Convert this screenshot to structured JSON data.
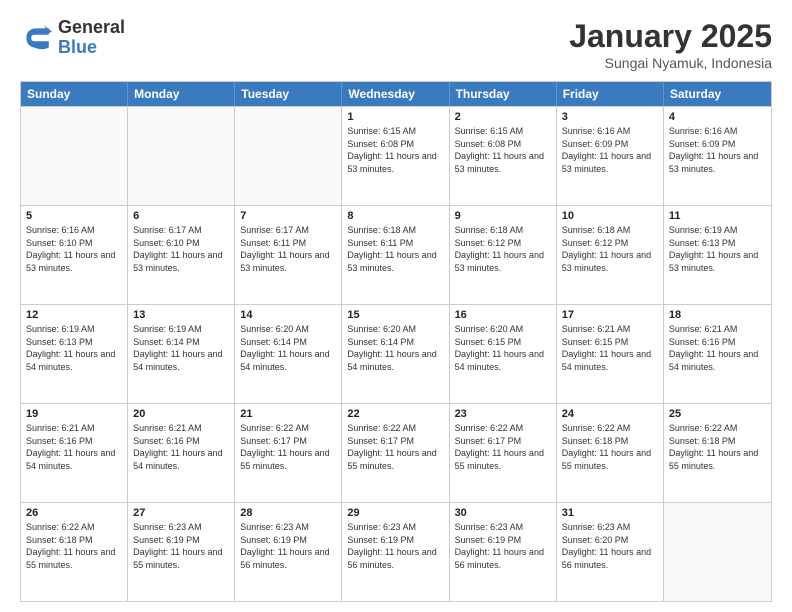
{
  "logo": {
    "general": "General",
    "blue": "Blue"
  },
  "header": {
    "month": "January 2025",
    "location": "Sungai Nyamuk, Indonesia"
  },
  "days": [
    "Sunday",
    "Monday",
    "Tuesday",
    "Wednesday",
    "Thursday",
    "Friday",
    "Saturday"
  ],
  "weeks": [
    [
      {
        "day": "",
        "info": ""
      },
      {
        "day": "",
        "info": ""
      },
      {
        "day": "",
        "info": ""
      },
      {
        "day": "1",
        "info": "Sunrise: 6:15 AM\nSunset: 6:08 PM\nDaylight: 11 hours and 53 minutes."
      },
      {
        "day": "2",
        "info": "Sunrise: 6:15 AM\nSunset: 6:08 PM\nDaylight: 11 hours and 53 minutes."
      },
      {
        "day": "3",
        "info": "Sunrise: 6:16 AM\nSunset: 6:09 PM\nDaylight: 11 hours and 53 minutes."
      },
      {
        "day": "4",
        "info": "Sunrise: 6:16 AM\nSunset: 6:09 PM\nDaylight: 11 hours and 53 minutes."
      }
    ],
    [
      {
        "day": "5",
        "info": "Sunrise: 6:16 AM\nSunset: 6:10 PM\nDaylight: 11 hours and 53 minutes."
      },
      {
        "day": "6",
        "info": "Sunrise: 6:17 AM\nSunset: 6:10 PM\nDaylight: 11 hours and 53 minutes."
      },
      {
        "day": "7",
        "info": "Sunrise: 6:17 AM\nSunset: 6:11 PM\nDaylight: 11 hours and 53 minutes."
      },
      {
        "day": "8",
        "info": "Sunrise: 6:18 AM\nSunset: 6:11 PM\nDaylight: 11 hours and 53 minutes."
      },
      {
        "day": "9",
        "info": "Sunrise: 6:18 AM\nSunset: 6:12 PM\nDaylight: 11 hours and 53 minutes."
      },
      {
        "day": "10",
        "info": "Sunrise: 6:18 AM\nSunset: 6:12 PM\nDaylight: 11 hours and 53 minutes."
      },
      {
        "day": "11",
        "info": "Sunrise: 6:19 AM\nSunset: 6:13 PM\nDaylight: 11 hours and 53 minutes."
      }
    ],
    [
      {
        "day": "12",
        "info": "Sunrise: 6:19 AM\nSunset: 6:13 PM\nDaylight: 11 hours and 54 minutes."
      },
      {
        "day": "13",
        "info": "Sunrise: 6:19 AM\nSunset: 6:14 PM\nDaylight: 11 hours and 54 minutes."
      },
      {
        "day": "14",
        "info": "Sunrise: 6:20 AM\nSunset: 6:14 PM\nDaylight: 11 hours and 54 minutes."
      },
      {
        "day": "15",
        "info": "Sunrise: 6:20 AM\nSunset: 6:14 PM\nDaylight: 11 hours and 54 minutes."
      },
      {
        "day": "16",
        "info": "Sunrise: 6:20 AM\nSunset: 6:15 PM\nDaylight: 11 hours and 54 minutes."
      },
      {
        "day": "17",
        "info": "Sunrise: 6:21 AM\nSunset: 6:15 PM\nDaylight: 11 hours and 54 minutes."
      },
      {
        "day": "18",
        "info": "Sunrise: 6:21 AM\nSunset: 6:16 PM\nDaylight: 11 hours and 54 minutes."
      }
    ],
    [
      {
        "day": "19",
        "info": "Sunrise: 6:21 AM\nSunset: 6:16 PM\nDaylight: 11 hours and 54 minutes."
      },
      {
        "day": "20",
        "info": "Sunrise: 6:21 AM\nSunset: 6:16 PM\nDaylight: 11 hours and 54 minutes."
      },
      {
        "day": "21",
        "info": "Sunrise: 6:22 AM\nSunset: 6:17 PM\nDaylight: 11 hours and 55 minutes."
      },
      {
        "day": "22",
        "info": "Sunrise: 6:22 AM\nSunset: 6:17 PM\nDaylight: 11 hours and 55 minutes."
      },
      {
        "day": "23",
        "info": "Sunrise: 6:22 AM\nSunset: 6:17 PM\nDaylight: 11 hours and 55 minutes."
      },
      {
        "day": "24",
        "info": "Sunrise: 6:22 AM\nSunset: 6:18 PM\nDaylight: 11 hours and 55 minutes."
      },
      {
        "day": "25",
        "info": "Sunrise: 6:22 AM\nSunset: 6:18 PM\nDaylight: 11 hours and 55 minutes."
      }
    ],
    [
      {
        "day": "26",
        "info": "Sunrise: 6:22 AM\nSunset: 6:18 PM\nDaylight: 11 hours and 55 minutes."
      },
      {
        "day": "27",
        "info": "Sunrise: 6:23 AM\nSunset: 6:19 PM\nDaylight: 11 hours and 55 minutes."
      },
      {
        "day": "28",
        "info": "Sunrise: 6:23 AM\nSunset: 6:19 PM\nDaylight: 11 hours and 56 minutes."
      },
      {
        "day": "29",
        "info": "Sunrise: 6:23 AM\nSunset: 6:19 PM\nDaylight: 11 hours and 56 minutes."
      },
      {
        "day": "30",
        "info": "Sunrise: 6:23 AM\nSunset: 6:19 PM\nDaylight: 11 hours and 56 minutes."
      },
      {
        "day": "31",
        "info": "Sunrise: 6:23 AM\nSunset: 6:20 PM\nDaylight: 11 hours and 56 minutes."
      },
      {
        "day": "",
        "info": ""
      }
    ]
  ]
}
